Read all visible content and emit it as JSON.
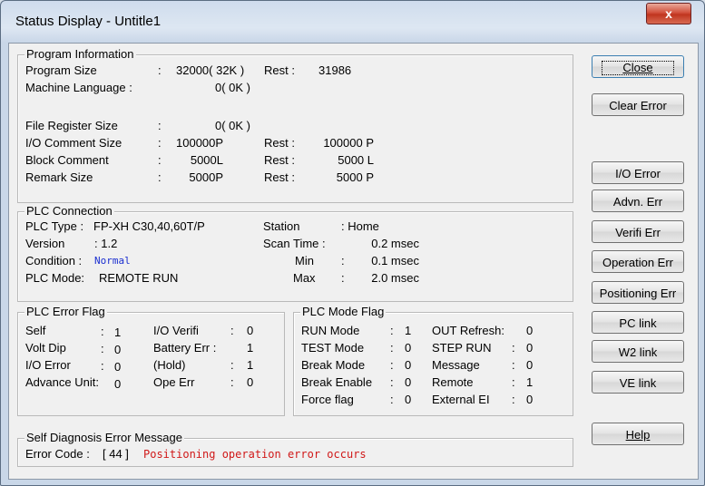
{
  "window": {
    "title": "Status Display - Untitle1",
    "close_glyph": "x"
  },
  "program_info": {
    "legend": "Program Information",
    "program_size_label": "Program Size",
    "program_size_value": "32000( 32K )",
    "program_rest_label": "Rest :",
    "program_rest_value": "31986",
    "machine_language_label": "Machine Language :",
    "machine_language_value": "0( 0K )",
    "file_register_label": "File Register Size",
    "file_register_value": "0( 0K )",
    "io_comment_label": "I/O Comment Size",
    "io_comment_value": "100000P",
    "io_comment_rest_label": "Rest :",
    "io_comment_rest_value": "100000 P",
    "block_comment_label": "Block Comment",
    "block_comment_value": "5000L",
    "block_comment_rest_label": "Rest :",
    "block_comment_rest_value": "5000 L",
    "remark_label": "Remark Size",
    "remark_value": "5000P",
    "remark_rest_label": "Rest :",
    "remark_rest_value": "5000 P"
  },
  "plc_connection": {
    "legend": "PLC Connection",
    "plc_type_label": "PLC Type :",
    "plc_type_value": "FP-XH C30,40,60T/P",
    "station_label": "Station",
    "station_value": ": Home",
    "version_label": "Version",
    "version_value": ": 1.2",
    "scan_time_label": "Scan Time :",
    "scan_time_value": "0.2 msec",
    "condition_label": "Condition :",
    "condition_value": "Normal",
    "min_label": "Min",
    "min_value": "0.1 msec",
    "plc_mode_label": "PLC Mode:",
    "plc_mode_value": "REMOTE RUN",
    "max_label": "Max",
    "max_value": "2.0 msec"
  },
  "plc_error_flag": {
    "legend": "PLC Error Flag",
    "rows": [
      {
        "label": "Self",
        "value": "1",
        "label2": "I/O Verifi",
        "value2": "0"
      },
      {
        "label": "Volt Dip",
        "value": "0",
        "label2": "Battery Err :",
        "value2": "1"
      },
      {
        "label": "I/O Error",
        "value": "0",
        "label2": "(Hold)",
        "value2": "1"
      },
      {
        "label": "Advance Unit:",
        "value": "0",
        "label2": "Ope Err",
        "value2": "0"
      }
    ]
  },
  "plc_mode_flag": {
    "legend": "PLC Mode Flag",
    "rows": [
      {
        "label": "RUN Mode",
        "value": "1",
        "label2": "OUT Refresh:",
        "value2": "0"
      },
      {
        "label": "TEST Mode",
        "value": "0",
        "label2": "STEP RUN",
        "value2": "0"
      },
      {
        "label": "Break Mode",
        "value": "0",
        "label2": "Message",
        "value2": "0"
      },
      {
        "label": "Break Enable",
        "value": "0",
        "label2": "Remote",
        "value2": "1"
      },
      {
        "label": "Force flag",
        "value": "0",
        "label2": "External EI",
        "value2": "0"
      }
    ]
  },
  "self_diagnosis": {
    "legend": "Self Diagnosis Error Message",
    "error_code_label": "Error Code :",
    "error_code_value": "[ 44 ]",
    "message": "Positioning operation error occurs"
  },
  "buttons": {
    "close": "Close",
    "clear_error": "Clear Error",
    "io_error": "I/O Error",
    "advn_err": "Advn. Err",
    "verifi_err": "Verifi Err",
    "operation_err": "Operation Err",
    "positioning_err": "Positioning Err",
    "pc_link": "PC link",
    "w2_link": "W2 link",
    "ve_link": "VE link",
    "help": "Help"
  }
}
